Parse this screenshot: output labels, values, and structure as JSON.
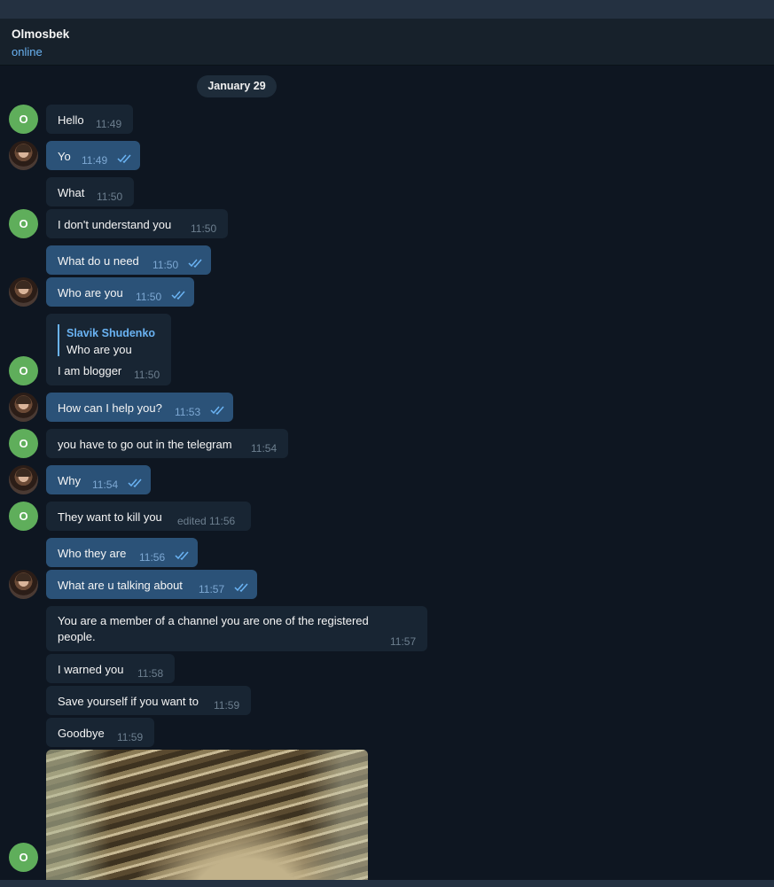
{
  "chat": {
    "name": "Olmosbek",
    "status": "online",
    "date": "January 29"
  },
  "avatars": {
    "contact_initial": "O"
  },
  "messages": [
    {
      "text": "Hello",
      "time": "11:49",
      "dir": "in"
    },
    {
      "text": "Yo",
      "time": "11:49",
      "dir": "out",
      "read": true
    },
    {
      "text": "What",
      "time": "11:50",
      "dir": "in"
    },
    {
      "text": "I don't understand you",
      "time": "11:50",
      "dir": "in"
    },
    {
      "text": "What do u need",
      "time": "11:50",
      "dir": "out",
      "read": true
    },
    {
      "text": "Who are you",
      "time": "11:50",
      "dir": "out",
      "read": true
    },
    {
      "text": "I am blogger",
      "time": "11:50",
      "dir": "in",
      "reply": {
        "name": "Slavik Shudenko",
        "text": "Who are you"
      }
    },
    {
      "text": "How can I help you?",
      "time": "11:53",
      "dir": "out",
      "read": true
    },
    {
      "text": "you have to go out in the telegram",
      "time": "11:54",
      "dir": "in"
    },
    {
      "text": "Why",
      "time": "11:54",
      "dir": "out",
      "read": true
    },
    {
      "text": "They want to kill you",
      "time": "edited 11:56",
      "dir": "in"
    },
    {
      "text": "Who they are",
      "time": "11:56",
      "dir": "out",
      "read": true
    },
    {
      "text": "What are u talking about",
      "time": "11:57",
      "dir": "out",
      "read": true
    },
    {
      "text_line1": "You are a member of a channel you are one of the registered",
      "text_line2": "people.",
      "time": "11:57",
      "dir": "in"
    },
    {
      "text": "I warned you",
      "time": "11:58",
      "dir": "in"
    },
    {
      "text": "Save yourself if you want to",
      "time": "11:59",
      "dir": "in"
    },
    {
      "text": "Goodbye",
      "time": "11:59",
      "dir": "in"
    }
  ],
  "colors": {
    "background": "#0e1621",
    "incoming_bubble": "#182533",
    "outgoing_bubble": "#2b5278",
    "accent": "#6ab3f3",
    "avatar_green": "#5fae5b"
  }
}
